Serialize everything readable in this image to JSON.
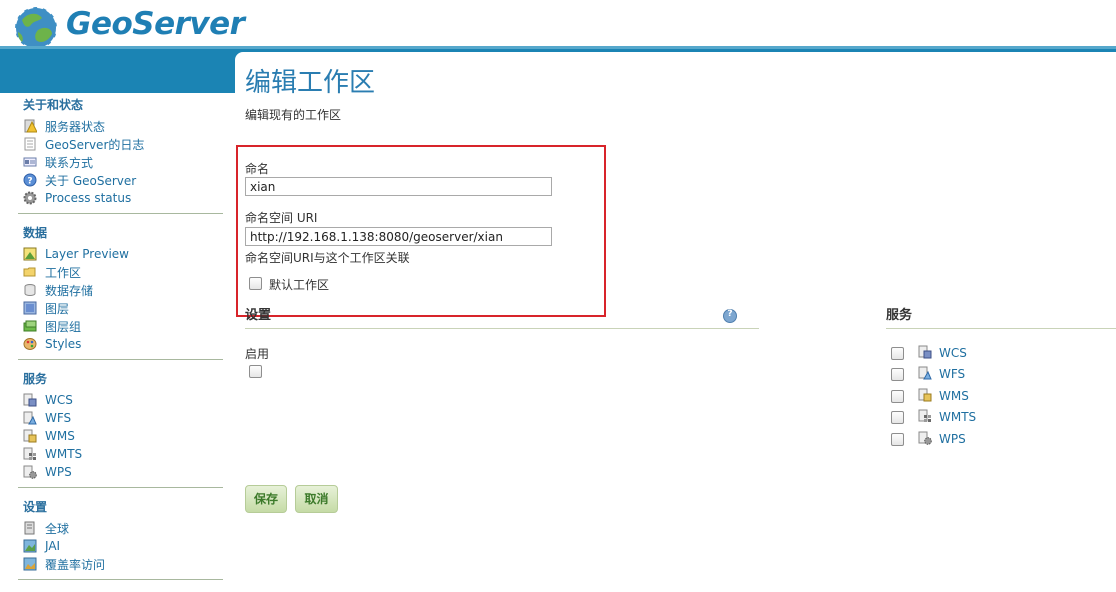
{
  "app": {
    "logo_text": "GeoServer"
  },
  "sidebar": {
    "sections": [
      {
        "title": "关于和状态",
        "items": [
          {
            "label": "服务器状态",
            "icon": "server-status-icon"
          },
          {
            "label": "GeoServer的日志",
            "icon": "log-icon"
          },
          {
            "label": "联系方式",
            "icon": "contact-icon"
          },
          {
            "label": "关于 GeoServer",
            "icon": "about-icon"
          },
          {
            "label": "Process status",
            "icon": "gear-icon"
          }
        ]
      },
      {
        "title": "数据",
        "items": [
          {
            "label": "Layer Preview",
            "icon": "layer-preview-icon"
          },
          {
            "label": "工作区",
            "icon": "folder-icon"
          },
          {
            "label": "数据存储",
            "icon": "database-icon"
          },
          {
            "label": "图层",
            "icon": "layer-icon"
          },
          {
            "label": "图层组",
            "icon": "layer-group-icon"
          },
          {
            "label": "Styles",
            "icon": "palette-icon"
          }
        ]
      },
      {
        "title": "服务",
        "items": [
          {
            "label": "WCS",
            "icon": "wcs-icon"
          },
          {
            "label": "WFS",
            "icon": "wfs-icon"
          },
          {
            "label": "WMS",
            "icon": "wms-icon"
          },
          {
            "label": "WMTS",
            "icon": "wmts-icon"
          },
          {
            "label": "WPS",
            "icon": "wps-icon"
          }
        ]
      },
      {
        "title": "设置",
        "items": [
          {
            "label": "全球",
            "icon": "global-settings-icon"
          },
          {
            "label": "JAI",
            "icon": "jai-icon"
          },
          {
            "label": "覆盖率访问",
            "icon": "coverage-access-icon"
          }
        ]
      }
    ]
  },
  "main": {
    "title": "编辑工作区",
    "description": "编辑现有的工作区",
    "name_label": "命名",
    "name_value": "xian",
    "uri_label": "命名空间 URI",
    "uri_value": "http://192.168.1.138:8080/geoserver/xian",
    "uri_help": "命名空间URI与这个工作区关联",
    "default_label": "默认工作区",
    "default_checked": false,
    "settings_title": "设置",
    "enabled_label": "启用",
    "enabled_checked": false,
    "services_title": "服务",
    "services": [
      {
        "label": "WCS",
        "checked": false
      },
      {
        "label": "WFS",
        "checked": false
      },
      {
        "label": "WMS",
        "checked": false
      },
      {
        "label": "WMTS",
        "checked": false
      },
      {
        "label": "WPS",
        "checked": false
      }
    ],
    "save_label": "保存",
    "cancel_label": "取消"
  },
  "colors": {
    "accent": "#1b84b4",
    "link": "#1f6fa0",
    "highlight_box": "#d8242a",
    "button_bg": "#c5dba6"
  }
}
